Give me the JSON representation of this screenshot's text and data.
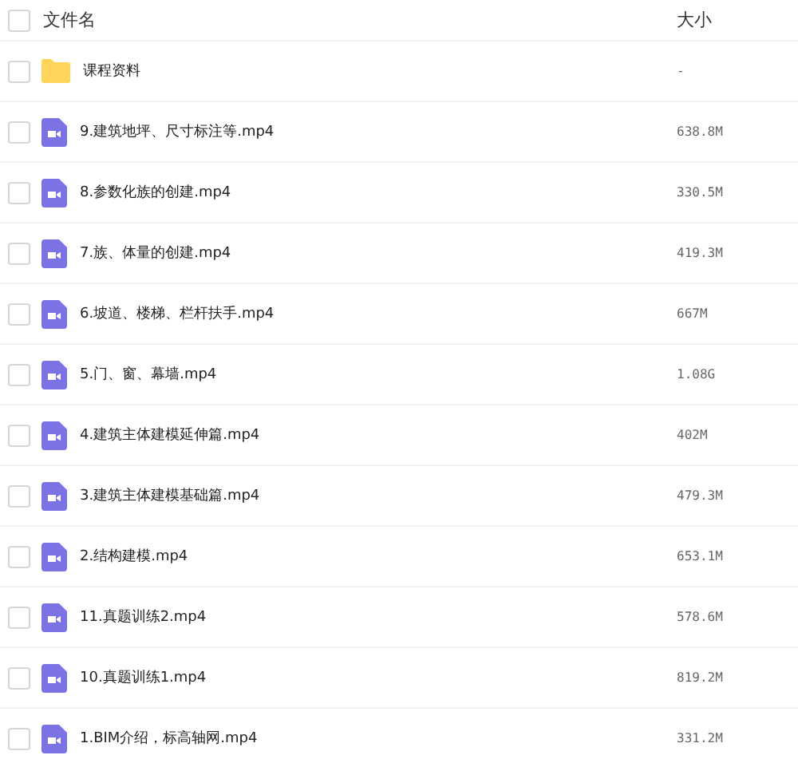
{
  "table": {
    "columns": [
      "文件名",
      "大小"
    ],
    "header_checked": false,
    "rows": [
      {
        "kind": "folder",
        "name": "课程资料",
        "size": "-",
        "checked": false
      },
      {
        "kind": "video",
        "name": "9.建筑地坪、尺寸标注等.mp4",
        "size": "638.8M",
        "checked": false
      },
      {
        "kind": "video",
        "name": "8.参数化族的创建.mp4",
        "size": "330.5M",
        "checked": false
      },
      {
        "kind": "video",
        "name": "7.族、体量的创建.mp4",
        "size": "419.3M",
        "checked": false
      },
      {
        "kind": "video",
        "name": "6.坡道、楼梯、栏杆扶手.mp4",
        "size": "667M",
        "checked": false
      },
      {
        "kind": "video",
        "name": "5.门、窗、幕墙.mp4",
        "size": "1.08G",
        "checked": false
      },
      {
        "kind": "video",
        "name": "4.建筑主体建模延伸篇.mp4",
        "size": "402M",
        "checked": false
      },
      {
        "kind": "video",
        "name": "3.建筑主体建模基础篇.mp4",
        "size": "479.3M",
        "checked": false
      },
      {
        "kind": "video",
        "name": "2.结构建模.mp4",
        "size": "653.1M",
        "checked": false
      },
      {
        "kind": "video",
        "name": "11.真题训练2.mp4",
        "size": "578.6M",
        "checked": false
      },
      {
        "kind": "video",
        "name": "10.真题训练1.mp4",
        "size": "819.2M",
        "checked": false
      },
      {
        "kind": "video",
        "name": "1.BIM介绍，标高轴网.mp4",
        "size": "331.2M",
        "checked": false
      }
    ]
  }
}
